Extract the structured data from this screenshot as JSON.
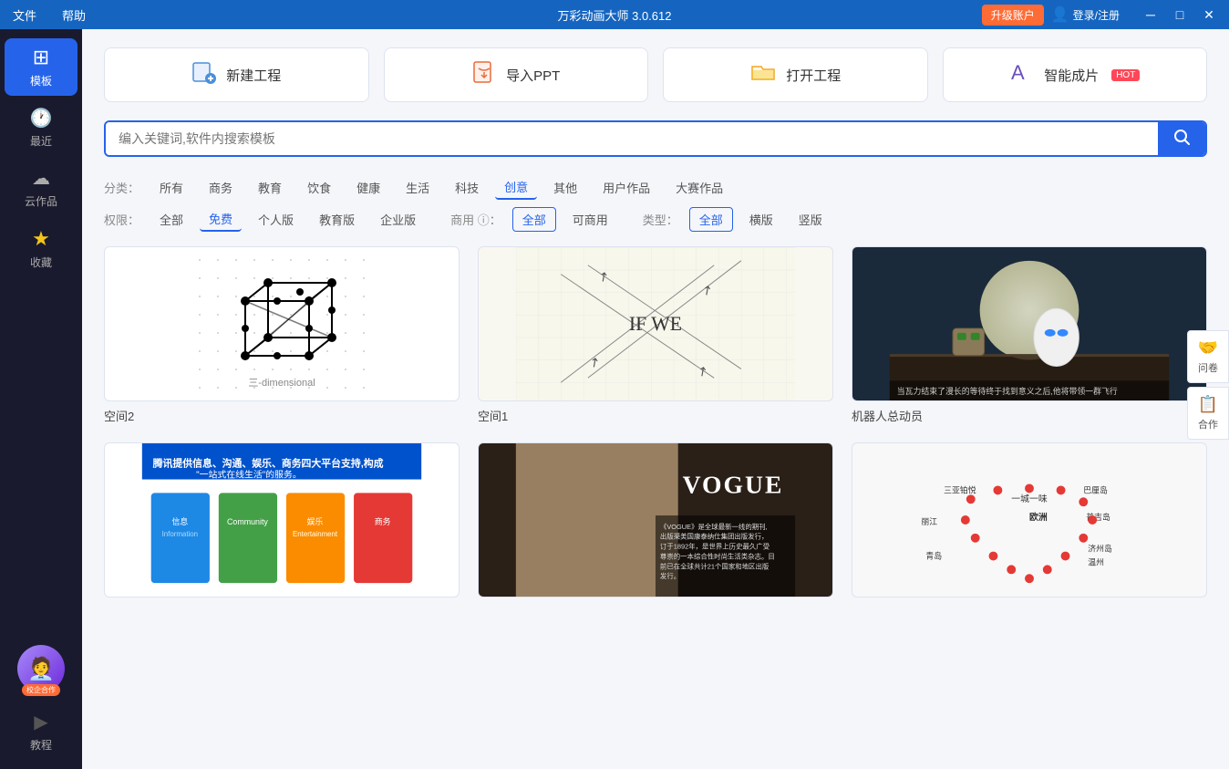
{
  "titlebar": {
    "menu_items": [
      "文件",
      "帮助"
    ],
    "title": "万彩动画大师 3.0.612",
    "upgrade_label": "升级账户",
    "login_label": "登录/注册",
    "win_min": "─",
    "win_max": "□",
    "win_close": "✕"
  },
  "sidebar": {
    "items": [
      {
        "id": "template",
        "icon": "⊞",
        "label": "模板",
        "active": true
      },
      {
        "id": "recent",
        "icon": "🕐",
        "label": "最近"
      },
      {
        "id": "cloud",
        "icon": "☁",
        "label": "云作品"
      },
      {
        "id": "favorite",
        "icon": "★",
        "label": "收藏"
      }
    ],
    "bottom": [
      {
        "id": "tutorial",
        "icon": "▶",
        "label": "教程"
      }
    ],
    "enterprise_label": "校企合作"
  },
  "actions": [
    {
      "id": "new",
      "icon_type": "new",
      "label": "新建工程"
    },
    {
      "id": "import",
      "icon_type": "import",
      "label": "导入PPT"
    },
    {
      "id": "open",
      "icon_type": "open",
      "label": "打开工程"
    },
    {
      "id": "ai",
      "icon_type": "ai",
      "label": "智能成片",
      "badge": "HOT"
    }
  ],
  "search": {
    "placeholder": "编入关键词,软件内搜索模板"
  },
  "filters": {
    "category_label": "分类：",
    "categories": [
      "所有",
      "商务",
      "教育",
      "饮食",
      "健康",
      "生活",
      "科技",
      "创意",
      "其他",
      "用户作品",
      "大赛作品"
    ],
    "active_category": "创意",
    "permission_label": "权限：",
    "permissions": [
      "全部",
      "免费",
      "个人版",
      "教育版",
      "企业版"
    ],
    "active_permission": "免费",
    "commercial_label": "商用 ⓘ：",
    "commercial": [
      "全部",
      "可商用"
    ],
    "active_commercial": "全部",
    "type_label": "类型：",
    "types": [
      "全部",
      "横版",
      "竖版"
    ],
    "active_type": "全部"
  },
  "templates": [
    {
      "id": "space2",
      "name": "空间2",
      "type": "geo"
    },
    {
      "id": "space1",
      "name": "空间1",
      "type": "grid"
    },
    {
      "id": "robot",
      "name": "机器人总动员",
      "type": "photo"
    },
    {
      "id": "tencent",
      "name": "",
      "type": "slide"
    },
    {
      "id": "vogue",
      "name": "",
      "type": "fashion"
    },
    {
      "id": "travel",
      "name": "",
      "type": "map"
    }
  ],
  "right_panel": [
    {
      "id": "survey",
      "icon": "🤝",
      "label": "问卷"
    },
    {
      "id": "coop",
      "icon": "📋",
      "label": "合作"
    }
  ]
}
